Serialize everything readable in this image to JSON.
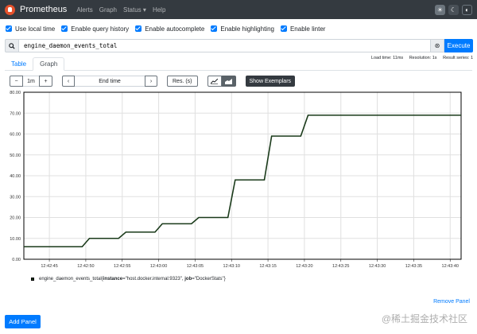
{
  "navbar": {
    "brand": "Prometheus",
    "links": [
      "Alerts",
      "Graph",
      "Status",
      "Help"
    ],
    "status_caret": "▾"
  },
  "options": [
    {
      "label": "Use local time",
      "checked": true
    },
    {
      "label": "Enable query history",
      "checked": true
    },
    {
      "label": "Enable autocomplete",
      "checked": true
    },
    {
      "label": "Enable highlighting",
      "checked": true
    },
    {
      "label": "Enable linter",
      "checked": true
    }
  ],
  "query": {
    "expression": "engine_daemon_events_total",
    "execute_label": "Execute"
  },
  "stats": {
    "load_time": "Load time: 11ms",
    "resolution": "Resolution: 1s",
    "result_series": "Result series: 1"
  },
  "tabs": [
    "Table",
    "Graph"
  ],
  "active_tab": "Graph",
  "controls": {
    "range": "1m",
    "end_time_placeholder": "End time",
    "resolution_placeholder": "Res. (s)",
    "exemplars_label": "Show Exemplars"
  },
  "chart_data": {
    "type": "line",
    "x_ticks": [
      "12:42:45",
      "12:42:50",
      "12:42:55",
      "12:43:00",
      "12:43:05",
      "12:43:10",
      "12:43:15",
      "12:43:20",
      "12:43:25",
      "12:43:30",
      "12:43:35",
      "12:43:40"
    ],
    "y_ticks": [
      "0.00",
      "10.00",
      "20.00",
      "30.00",
      "40.00",
      "50.00",
      "60.00",
      "70.00",
      "80.00"
    ],
    "ylim": [
      0,
      80
    ],
    "xlim_seconds": [
      -3.5,
      56.5
    ],
    "series": [
      {
        "name": "engine_daemon_events_total{instance=\"host.docker.internal:9323\", job=\"DockerStats\"}",
        "color": "#1a3a1a",
        "points": [
          [
            -3.5,
            6
          ],
          [
            4.5,
            6
          ],
          [
            5.5,
            10
          ],
          [
            9.5,
            10
          ],
          [
            10.5,
            13
          ],
          [
            14.5,
            13
          ],
          [
            15.5,
            17
          ],
          [
            19.5,
            17
          ],
          [
            20.5,
            20
          ],
          [
            24.5,
            20
          ],
          [
            25.5,
            38
          ],
          [
            29.5,
            38
          ],
          [
            30.5,
            59
          ],
          [
            34.5,
            59
          ],
          [
            35.5,
            69
          ],
          [
            56.5,
            69
          ]
        ]
      }
    ],
    "grid": true
  },
  "legend": {
    "metric": "engine_daemon_events_total",
    "labels_prefix": "{",
    "label1_key": "instance",
    "label1_value": "=\"host.docker.internal:9323\"",
    "label2_key": "job",
    "label2_value": "=\"DockerStats\"}"
  },
  "remove_panel": "Remove Panel",
  "add_panel": "Add Panel",
  "watermark": "@稀土掘金技术社区"
}
